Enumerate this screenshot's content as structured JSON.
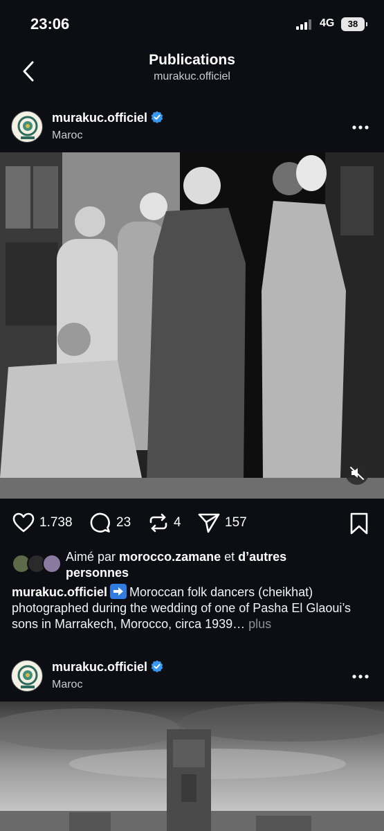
{
  "status_bar": {
    "time": "23:06",
    "network": "4G",
    "battery": "38"
  },
  "nav": {
    "title": "Publications",
    "subtitle": "murakuc.officiel"
  },
  "posts": [
    {
      "username": "murakuc.officiel",
      "location": "Maroc"
    },
    {
      "username": "murakuc.officiel",
      "location": "Maroc"
    }
  ],
  "actions": {
    "likes": "1.738",
    "comments": "23",
    "reposts": "4",
    "shares": "157"
  },
  "liked_by": {
    "prefix": "Aimé par",
    "user": "morocco.zamane",
    "joiner": "et",
    "others": "d’autres personnes"
  },
  "caption": {
    "username": "murakuc.officiel",
    "text": "Moroccan folk dancers (cheikhat) photographed during the wedding of one of Pasha El Glaoui’s sons in Marrakech, Morocco, circa 1939…",
    "more": "plus"
  },
  "icons": {
    "back": "chevron-left-icon",
    "verified": "verified-badge-icon",
    "more": "more-dots-icon",
    "like": "heart-icon",
    "comment": "comment-icon",
    "repost": "repost-icon",
    "share": "paper-plane-icon",
    "save": "bookmark-icon",
    "mute": "speaker-muted-icon"
  },
  "colors": {
    "background": "#0c0e14",
    "verified": "#3897f0",
    "muted_text": "#8e9199"
  }
}
